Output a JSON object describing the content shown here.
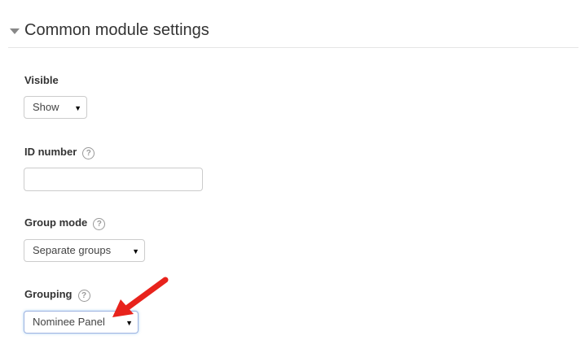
{
  "section": {
    "title": "Common module settings"
  },
  "fields": {
    "visible": {
      "label": "Visible",
      "value": "Show"
    },
    "id_number": {
      "label": "ID number",
      "value": ""
    },
    "group_mode": {
      "label": "Group mode",
      "value": "Separate groups"
    },
    "grouping": {
      "label": "Grouping",
      "value": "Nominee Panel"
    }
  },
  "icons": {
    "collapse": "triangle-down-icon",
    "help": "question-circle-icon",
    "caret": "caret-down-icon",
    "annotation": "red-arrow-icon"
  },
  "colors": {
    "annotation_arrow": "#e8231c",
    "focus_border": "#9fb3e0"
  }
}
